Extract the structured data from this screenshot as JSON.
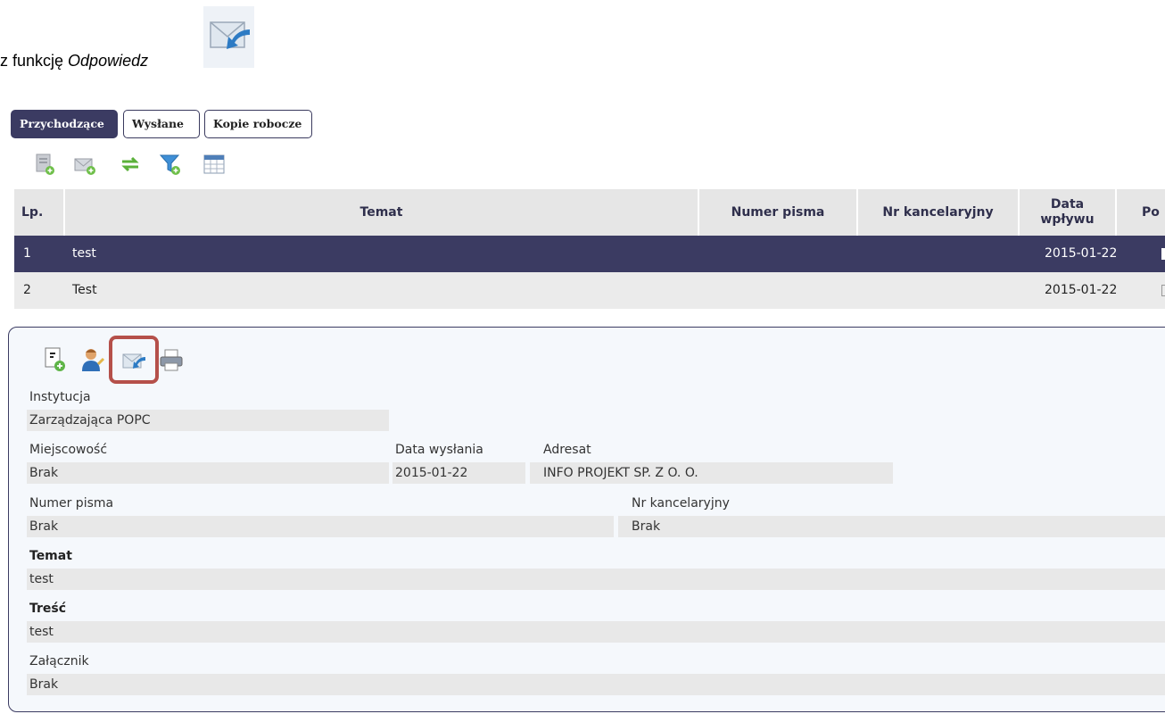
{
  "intro": {
    "prefix": "z funkcję ",
    "italic": "Odpowiedz"
  },
  "tabs": [
    {
      "label": "Przychodzące",
      "active": true
    },
    {
      "label": "Wysłane",
      "active": false
    },
    {
      "label": "Kopie robocze",
      "active": false
    }
  ],
  "toolbar_icons": [
    "new-document-icon",
    "new-message-icon",
    "refresh-icon",
    "filter-icon",
    "table-columns-icon"
  ],
  "table": {
    "headers": {
      "lp": "Lp.",
      "temat": "Temat",
      "numer_pisma": "Numer pisma",
      "nr_kancelaryjny": "Nr kancelaryjny",
      "data_wplywu": "Data\nwpływu",
      "podglad": "Po"
    },
    "rows": [
      {
        "lp": "1",
        "temat": "test",
        "numer_pisma": "",
        "nr_kancelaryjny": "",
        "data": "2015-01-22",
        "selected": true
      },
      {
        "lp": "2",
        "temat": "Test",
        "numer_pisma": "",
        "nr_kancelaryjny": "",
        "data": "2015-01-22",
        "selected": false
      }
    ]
  },
  "details": {
    "actions": [
      "new-attachment-icon",
      "assign-user-icon",
      "reply-icon",
      "print-icon"
    ],
    "instytucja_label": "Instytucja",
    "instytucja_value": "Zarządzająca POPC",
    "miejscowosc_label": "Miejscowość",
    "miejscowosc_value": "Brak",
    "data_wyslania_label": "Data wysłania",
    "data_wyslania_value": "2015-01-22",
    "adresat_label": "Adresat",
    "adresat_value": "INFO PROJEKT SP. Z O. O.",
    "numer_pisma_label": "Numer pisma",
    "numer_pisma_value": "Brak",
    "nr_kancelaryjny_label": "Nr kancelaryjny",
    "nr_kancelaryjny_value": "Brak",
    "temat_label": "Temat",
    "temat_value": "test",
    "tresc_label": "Treść",
    "tresc_value": "test",
    "zalacznik_label": "Załącznik",
    "zalacznik_value": "Brak"
  },
  "colors": {
    "primary": "#3b3b62",
    "highlight": "#b5504a",
    "panel_bg": "#f5f8fc"
  }
}
